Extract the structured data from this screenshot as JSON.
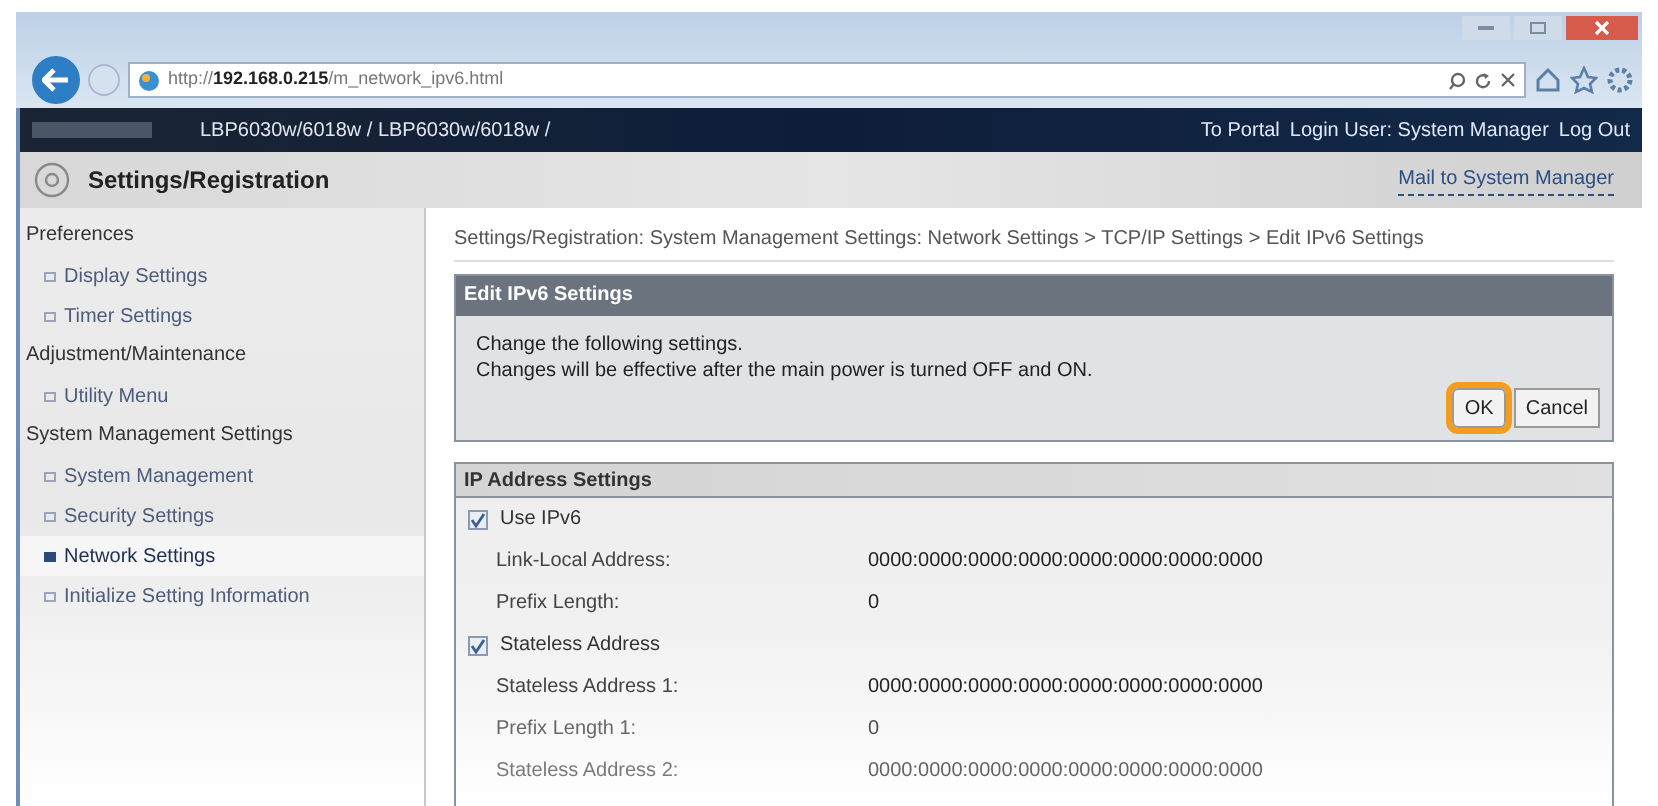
{
  "browser": {
    "url_prefix": "http://",
    "url_host": "192.168.0.215",
    "url_path": "/m_network_ipv6.html"
  },
  "top_bar": {
    "title": "LBP6030w/6018w / LBP6030w/6018w /",
    "links": [
      "To Portal",
      "Login User: System Manager",
      "Log Out"
    ]
  },
  "header": {
    "title": "Settings/Registration",
    "link": "Mail to System Manager"
  },
  "sidebar": [
    {
      "label": "Preferences",
      "children": [
        {
          "label": "Display Settings",
          "selected": false
        },
        {
          "label": "Timer Settings",
          "selected": false
        }
      ]
    },
    {
      "label": "Adjustment/Maintenance",
      "children": [
        {
          "label": "Utility Menu",
          "selected": false
        }
      ]
    },
    {
      "label": "System Management Settings",
      "children": [
        {
          "label": "System Management",
          "selected": false
        },
        {
          "label": "Security Settings",
          "selected": false
        },
        {
          "label": "Network Settings",
          "selected": true
        },
        {
          "label": "Initialize Setting Information",
          "selected": false
        }
      ]
    }
  ],
  "breadcrumb": "Settings/Registration: System Management Settings: Network Settings > TCP/IP Settings > Edit IPv6 Settings",
  "edit_panel": {
    "title": "Edit IPv6 Settings",
    "lines": [
      "Change the following settings.",
      "Changes will be effective after the main power is turned OFF and ON."
    ],
    "buttons": [
      {
        "label": "OK",
        "highlighted": true
      },
      {
        "label": "Cancel",
        "highlighted": false
      }
    ]
  },
  "ip_section": {
    "title": "IP Address Settings",
    "rows": [
      {
        "kind": "checkbox",
        "label": "Use IPv6",
        "checked": true
      },
      {
        "kind": "field",
        "label": "Link-Local Address:",
        "value": "0000:0000:0000:0000:0000:0000:0000:0000"
      },
      {
        "kind": "field",
        "label": "Prefix Length:",
        "value": "0"
      },
      {
        "kind": "checkbox",
        "label": "Stateless Address",
        "checked": true
      },
      {
        "kind": "field",
        "label": "Stateless Address 1:",
        "value": "0000:0000:0000:0000:0000:0000:0000:0000"
      },
      {
        "kind": "field",
        "label": "Prefix Length 1:",
        "value": "0"
      },
      {
        "kind": "field",
        "label": "Stateless Address 2:",
        "value": "0000:0000:0000:0000:0000:0000:0000:0000"
      }
    ]
  }
}
